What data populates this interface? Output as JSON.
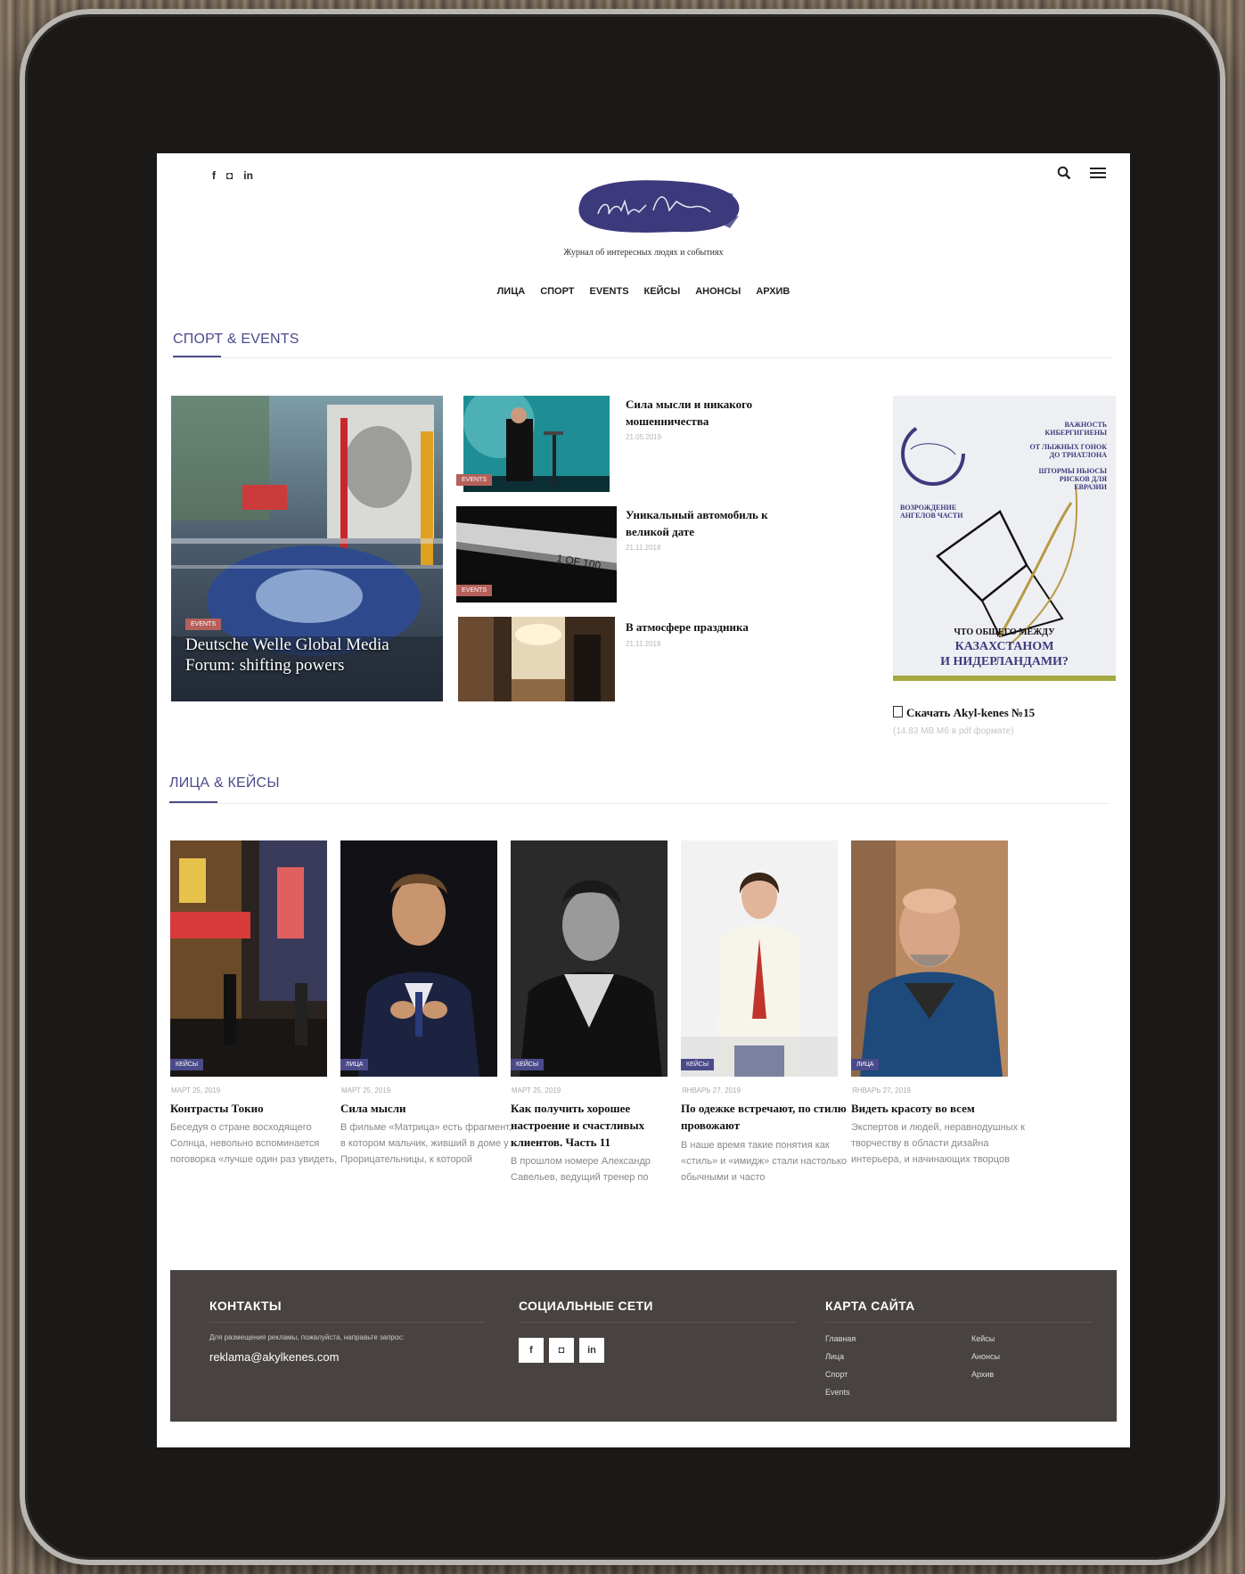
{
  "header": {
    "social": [
      "f",
      "◘",
      "in"
    ],
    "tagline": "Журнал об интересных людях и событиях",
    "logo_text": "akyl-kenes"
  },
  "nav": [
    "ЛИЦА",
    "СПОРТ",
    "EVENTS",
    "КЕЙСЫ",
    "АНОНСЫ",
    "АРХИВ"
  ],
  "section1": {
    "title": "СПОРТ & EVENTS",
    "featured": {
      "tag": "EVENTS",
      "title": "Deutsche Welle Global Media Forum: shifting powers"
    },
    "items": [
      {
        "tag": "EVENTS",
        "title": "Сила мысли и никакого мошенничества",
        "date": "21.05.2019"
      },
      {
        "tag": "EVENTS",
        "title": "Уникальный автомобиль к великой дате",
        "date": "21.11.2018"
      },
      {
        "tag": "EVENTS",
        "title": "В атмосфере праздника",
        "date": "21.11.2018"
      }
    ],
    "car_plate": "1 OF 100",
    "cover": {
      "headline_top": [
        "ВАЖНОСТЬ",
        "КИБЕРГИГИЕНЫ"
      ],
      "line2": [
        "ОТ ЛЫЖНЫХ ГОНОК",
        "ДО ТРИАТЛОНА"
      ],
      "line3": [
        "ШТОРМЫ НЬЮСЫ",
        "РИСКОВ ДЛЯ",
        "ЕВРАЗИИ"
      ],
      "left_text": [
        "ВОЗРОЖДЕНИЕ",
        "АНГЕЛОВ ЧАСТИ"
      ],
      "question": [
        "ЧТО ОБЩЕГО МЕЖДУ"
      ],
      "countries": [
        "КАЗАХСТАНОМ",
        "И НИДЕРЛАНДАМИ?"
      ]
    },
    "download": {
      "label": "Скачать Akyl-kenes №15",
      "size": "(14.83 MB Мб в pdf формате)"
    }
  },
  "section2": {
    "title": "ЛИЦА & КЕЙСЫ",
    "cards": [
      {
        "tag": "КЕЙСЫ",
        "date": "МАРТ 25, 2019",
        "title": "Контрасты Токио",
        "excerpt": "Беседуя о стране восходящего Солнца, невольно вспоминается поговорка «лучше один раз увидеть, чем сто раз услышать»"
      },
      {
        "tag": "ЛИЦА",
        "date": "МАРТ 25, 2019",
        "title": "Сила мысли",
        "excerpt": "В фильме «Матрица» есть фрагмент, в котором мальчик, живший в доме у Прорицательницы, к которой"
      },
      {
        "tag": "КЕЙСЫ",
        "date": "МАРТ 25, 2019",
        "title": "Как получить хорошее настроение и счастливых клиентов. Часть 11",
        "excerpt": "В прошлом номере Александр Савельев, ведущий тренер по"
      },
      {
        "tag": "КЕЙСЫ",
        "date": "ЯНВАРЬ 27, 2019",
        "title": "По одежке встречают, по стилю провожают",
        "excerpt": "В наше время такие понятия как «стиль» и «имидж» стали настолько обычными и часто"
      },
      {
        "tag": "ЛИЦА",
        "date": "ЯНВАРЬ 27, 2019",
        "title": "Видеть красоту во всем",
        "excerpt": "Экспертов и людей, неравнодушных к творчеству в области дизайна интерьера, и начинающих творцов"
      }
    ]
  },
  "footer": {
    "contacts": {
      "title": "КОНТАКТЫ",
      "note": "Для размещения рекламы, пожалуйста, направьте запрос:",
      "email": "reklama@akylkenes.com"
    },
    "social": {
      "title": "СОЦИАЛЬНЫЕ СЕТИ",
      "icons": [
        "f",
        "◘",
        "in"
      ]
    },
    "sitemap": {
      "title": "КАРТА САЙТА",
      "col1": [
        "Главная",
        "Лица",
        "Спорт",
        "Events"
      ],
      "col2": [
        "Кейсы",
        "Анонсы",
        "Архив"
      ]
    }
  }
}
